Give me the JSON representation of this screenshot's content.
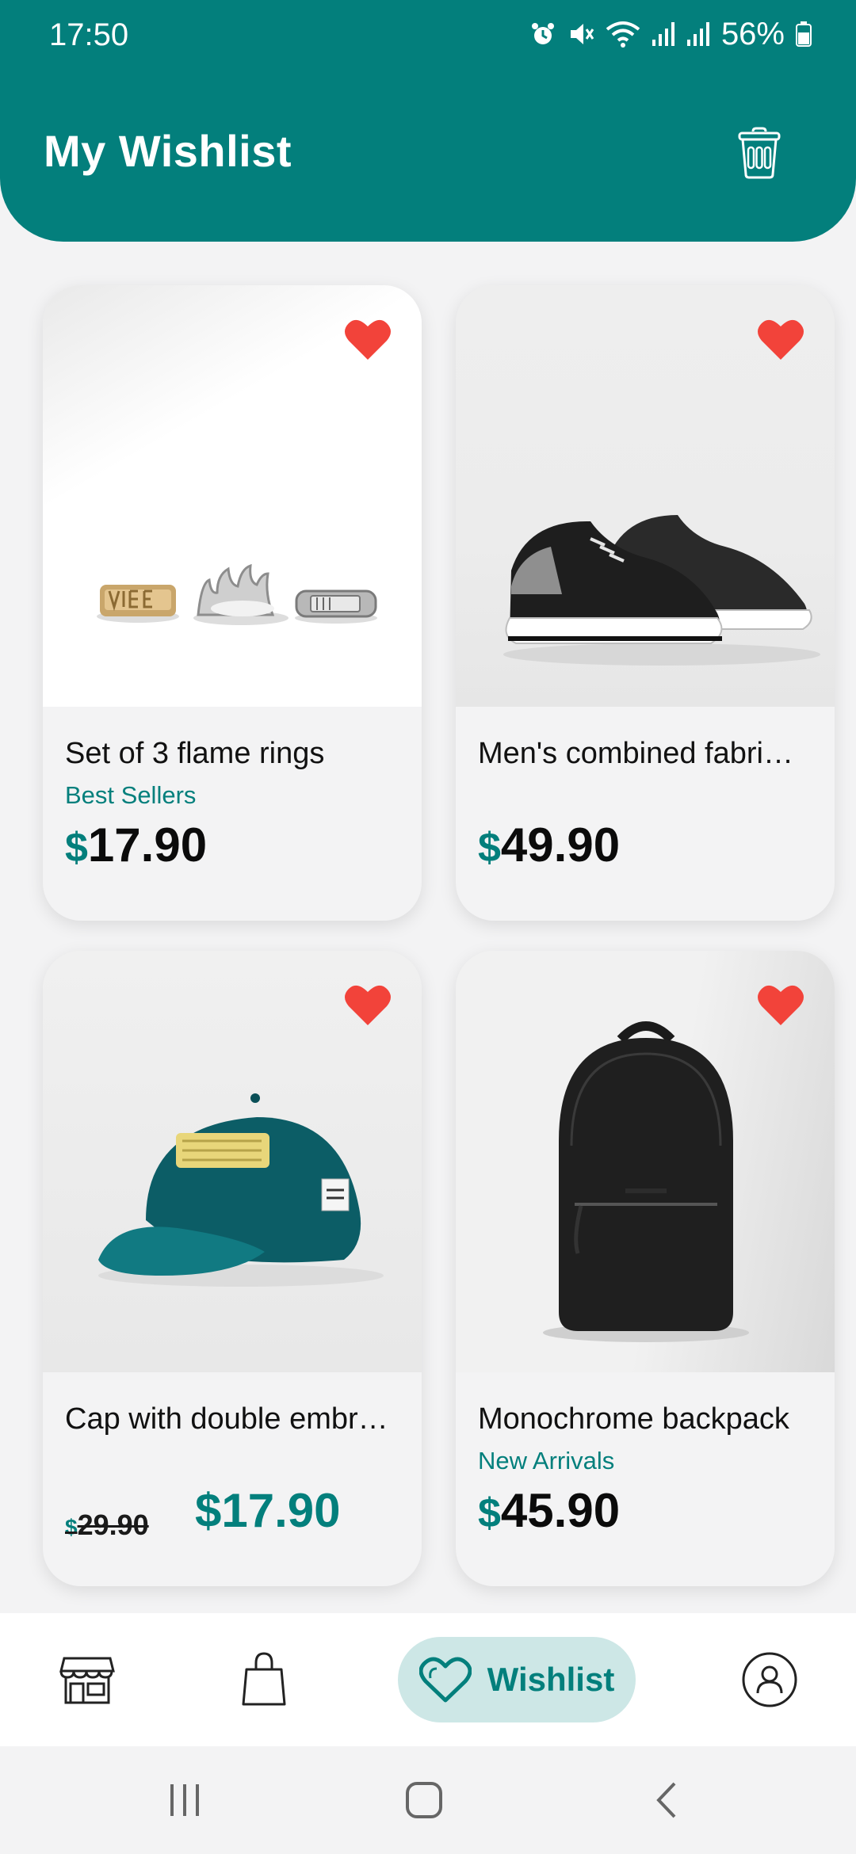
{
  "status_bar": {
    "time": "17:50",
    "battery": "56%",
    "icons": [
      "alarm-icon",
      "mute-icon",
      "wifi-icon",
      "signal-icon",
      "signal-icon",
      "battery-icon"
    ]
  },
  "header": {
    "title": "My Wishlist",
    "action_icon": "trash-icon"
  },
  "products": [
    {
      "name": "Set of 3 flame rings",
      "category": "Best Sellers",
      "currency": "$",
      "price": "17.90",
      "favorited": true
    },
    {
      "name": "Men's combined fabri…",
      "category": "",
      "currency": "$",
      "price": "49.90",
      "favorited": true
    },
    {
      "name": "Cap with double embr…",
      "category": "",
      "currency": "$",
      "old_price": "29.90",
      "price": "$17.90",
      "favorited": true
    },
    {
      "name": "Monochrome backpack",
      "category": "New Arrivals",
      "currency": "$",
      "price": "45.90",
      "favorited": true
    }
  ],
  "bottom_nav": {
    "items": [
      {
        "icon": "store-icon",
        "label": ""
      },
      {
        "icon": "shopping-bag-icon",
        "label": ""
      },
      {
        "icon": "heart-icon",
        "label": "Wishlist",
        "active": true
      },
      {
        "icon": "profile-icon",
        "label": ""
      }
    ]
  },
  "system_nav": [
    "recents-icon",
    "home-icon",
    "back-icon"
  ],
  "colors": {
    "accent": "#037f7c",
    "accent_light": "#cde7e6",
    "heart": "#f2433a",
    "background": "#f3f3f4"
  }
}
